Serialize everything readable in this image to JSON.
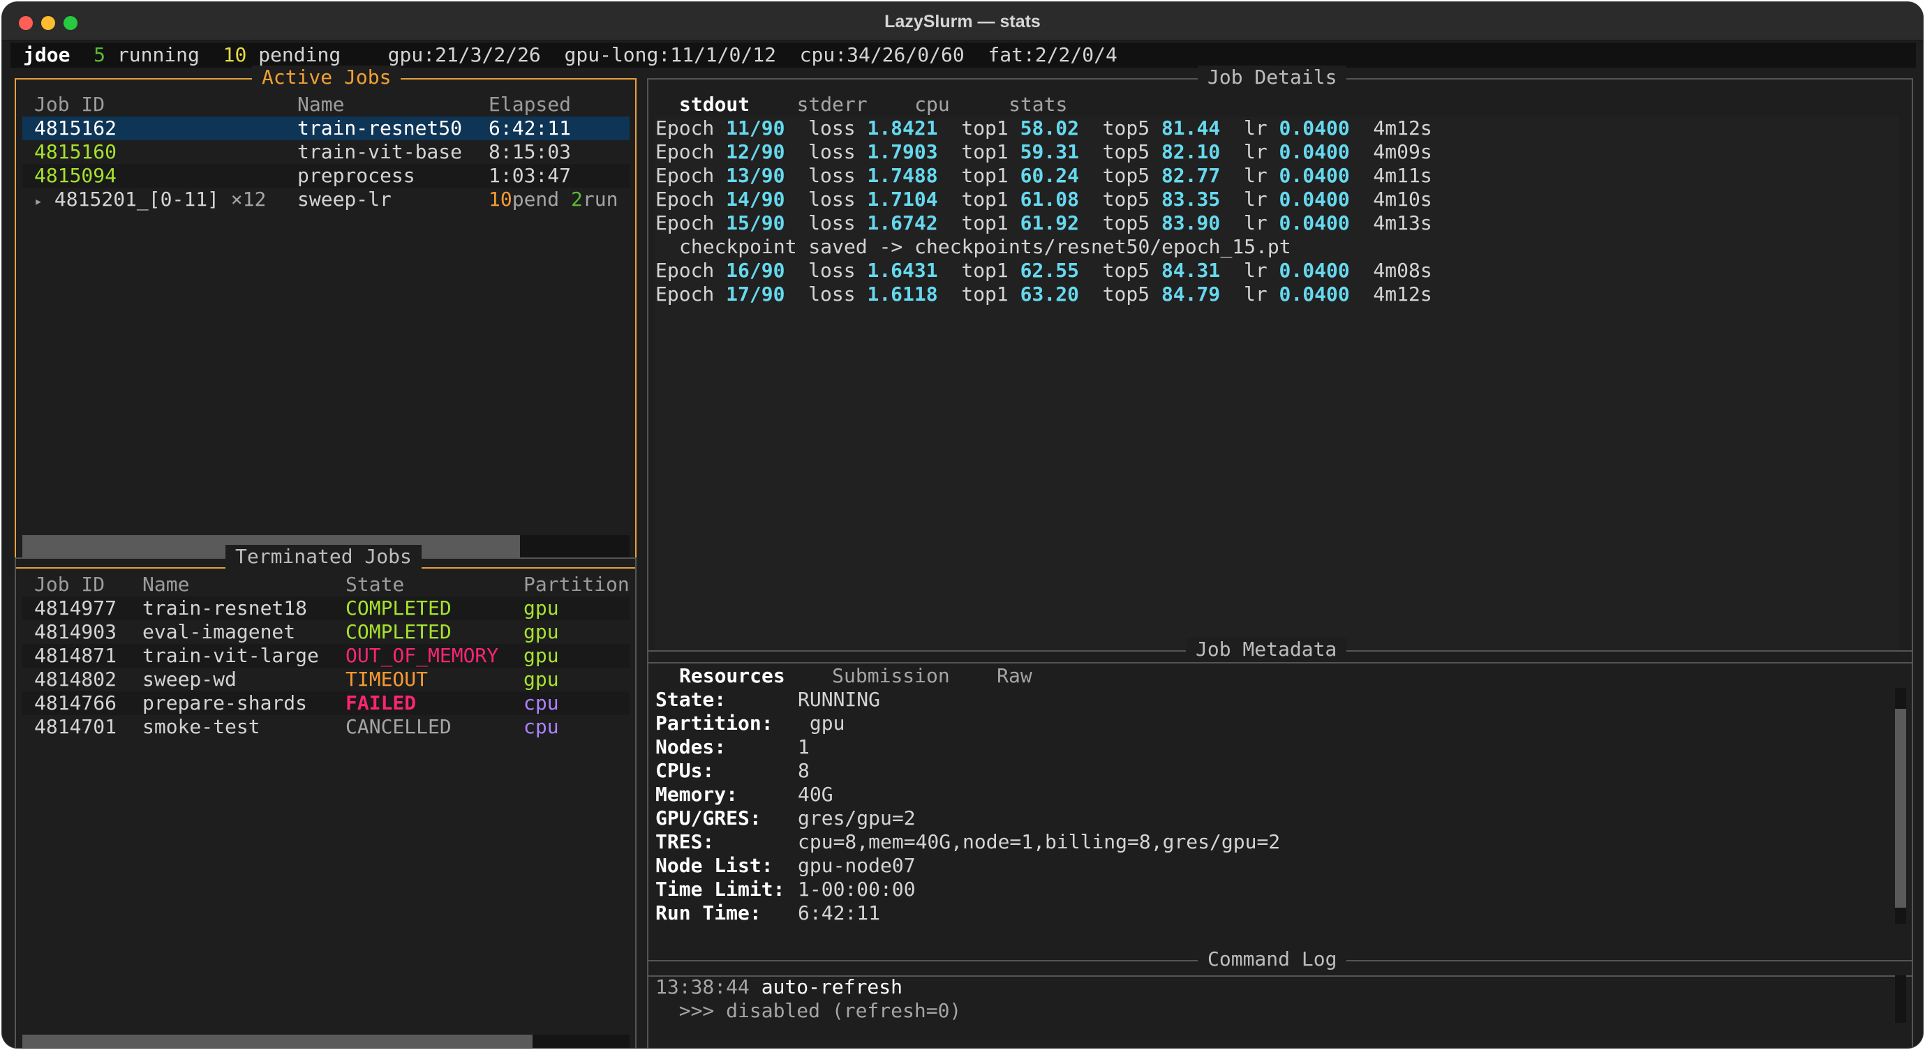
{
  "window": {
    "title": "LazySlurm — stats",
    "traffic_colors": {
      "close": "#ff5f57",
      "minimize": "#febc2e",
      "maximize": "#28c840"
    }
  },
  "status": {
    "user": "jdoe",
    "running_count": "5",
    "running_label": "running",
    "pending_count": "10",
    "pending_label": "pending",
    "partitions": [
      "gpu:21/3/2/26",
      "gpu-long:11/1/0/12",
      "cpu:34/26/0/60",
      "fat:2/2/0/4"
    ]
  },
  "active_jobs": {
    "title": "Active Jobs",
    "headers": {
      "id": "Job ID",
      "name": "Name",
      "elapsed": "Elapsed"
    },
    "rows": [
      {
        "id": "4815162",
        "name": "train-resnet50",
        "elapsed": "6:42:11"
      },
      {
        "id": "4815160",
        "name": "train-vit-base",
        "elapsed": "8:15:03"
      },
      {
        "id": "4815094",
        "name": "preprocess",
        "elapsed": "1:03:47"
      }
    ],
    "array_row": {
      "arrow": "▸",
      "id": "4815201_[0-11]",
      "multiplier": "×12",
      "name": "sweep-lr",
      "pend_count": "10",
      "pend_label": "pend",
      "run_count": "2",
      "run_label": "run"
    },
    "hscroll_fraction": 0.82
  },
  "terminated_jobs": {
    "title": "Terminated Jobs",
    "headers": {
      "id": "Job ID",
      "name": "Name",
      "state": "State",
      "partition": "Partition"
    },
    "rows": [
      {
        "id": "4814977",
        "name": "train-resnet18",
        "state": "COMPLETED",
        "partition": "gpu"
      },
      {
        "id": "4814903",
        "name": "eval-imagenet",
        "state": "COMPLETED",
        "partition": "gpu"
      },
      {
        "id": "4814871",
        "name": "train-vit-large",
        "state": "OUT_OF_MEMORY",
        "partition": "gpu"
      },
      {
        "id": "4814802",
        "name": "sweep-wd",
        "state": "TIMEOUT",
        "partition": "gpu"
      },
      {
        "id": "4814766",
        "name": "prepare-shards",
        "state": "FAILED",
        "partition": "cpu"
      },
      {
        "id": "4814701",
        "name": "smoke-test",
        "state": "CANCELLED",
        "partition": "cpu"
      }
    ],
    "hscroll_fraction": 0.84
  },
  "job_details": {
    "title": "Job Details",
    "tabs": [
      "stdout",
      "stderr",
      "cpu",
      "stats"
    ],
    "active_tab": 0,
    "labels": {
      "epoch": "Epoch",
      "loss": "loss",
      "top1": "top1",
      "top5": "top5",
      "lr": "lr"
    },
    "lines": [
      {
        "epoch": "11",
        "total": "90",
        "loss": "1.8421",
        "top1": "58.02",
        "top5": "81.44",
        "lr": "0.0400",
        "time": "4m12s"
      },
      {
        "epoch": "12",
        "total": "90",
        "loss": "1.7903",
        "top1": "59.31",
        "top5": "82.10",
        "lr": "0.0400",
        "time": "4m09s"
      },
      {
        "epoch": "13",
        "total": "90",
        "loss": "1.7488",
        "top1": "60.24",
        "top5": "82.77",
        "lr": "0.0400",
        "time": "4m11s"
      },
      {
        "epoch": "14",
        "total": "90",
        "loss": "1.7104",
        "top1": "61.08",
        "top5": "83.35",
        "lr": "0.0400",
        "time": "4m10s"
      },
      {
        "epoch": "15",
        "total": "90",
        "loss": "1.6742",
        "top1": "61.92",
        "top5": "83.90",
        "lr": "0.0400",
        "time": "4m13s"
      },
      {
        "checkpoint": "checkpoint saved -> checkpoints/resnet50/epoch_15.pt"
      },
      {
        "epoch": "16",
        "total": "90",
        "loss": "1.6431",
        "top1": "62.55",
        "top5": "84.31",
        "lr": "0.0400",
        "time": "4m08s"
      },
      {
        "epoch": "17",
        "total": "90",
        "loss": "1.6118",
        "top1": "63.20",
        "top5": "84.79",
        "lr": "0.0400",
        "time": "4m12s"
      }
    ]
  },
  "job_metadata": {
    "title": "Job Metadata",
    "tabs": [
      "Resources",
      "Submission",
      "Raw"
    ],
    "active_tab": 0,
    "fields": [
      {
        "key": "State:",
        "value": "RUNNING"
      },
      {
        "key": "Partition:",
        "value": " gpu"
      },
      {
        "key": "Nodes:",
        "value": "1"
      },
      {
        "key": "CPUs:",
        "value": "8"
      },
      {
        "key": "Memory:",
        "value": "40G"
      },
      {
        "key": "GPU/GRES:",
        "value": "gres/gpu=2"
      },
      {
        "key": "TRES:",
        "value": "cpu=8,mem=40G,node=1,billing=8,gres/gpu=2"
      },
      {
        "key": "Node List:",
        "value": "gpu-node07"
      },
      {
        "key": "Time Limit:",
        "value": "1-00:00:00"
      },
      {
        "key": "Run Time:",
        "value": "6:42:11"
      }
    ]
  },
  "command_log": {
    "title": "Command Log",
    "lines": [
      {
        "time": "13:38:44",
        "text": "auto-refresh"
      },
      {
        "time": "",
        "text": "  >>> disabled (refresh=0)"
      }
    ]
  }
}
